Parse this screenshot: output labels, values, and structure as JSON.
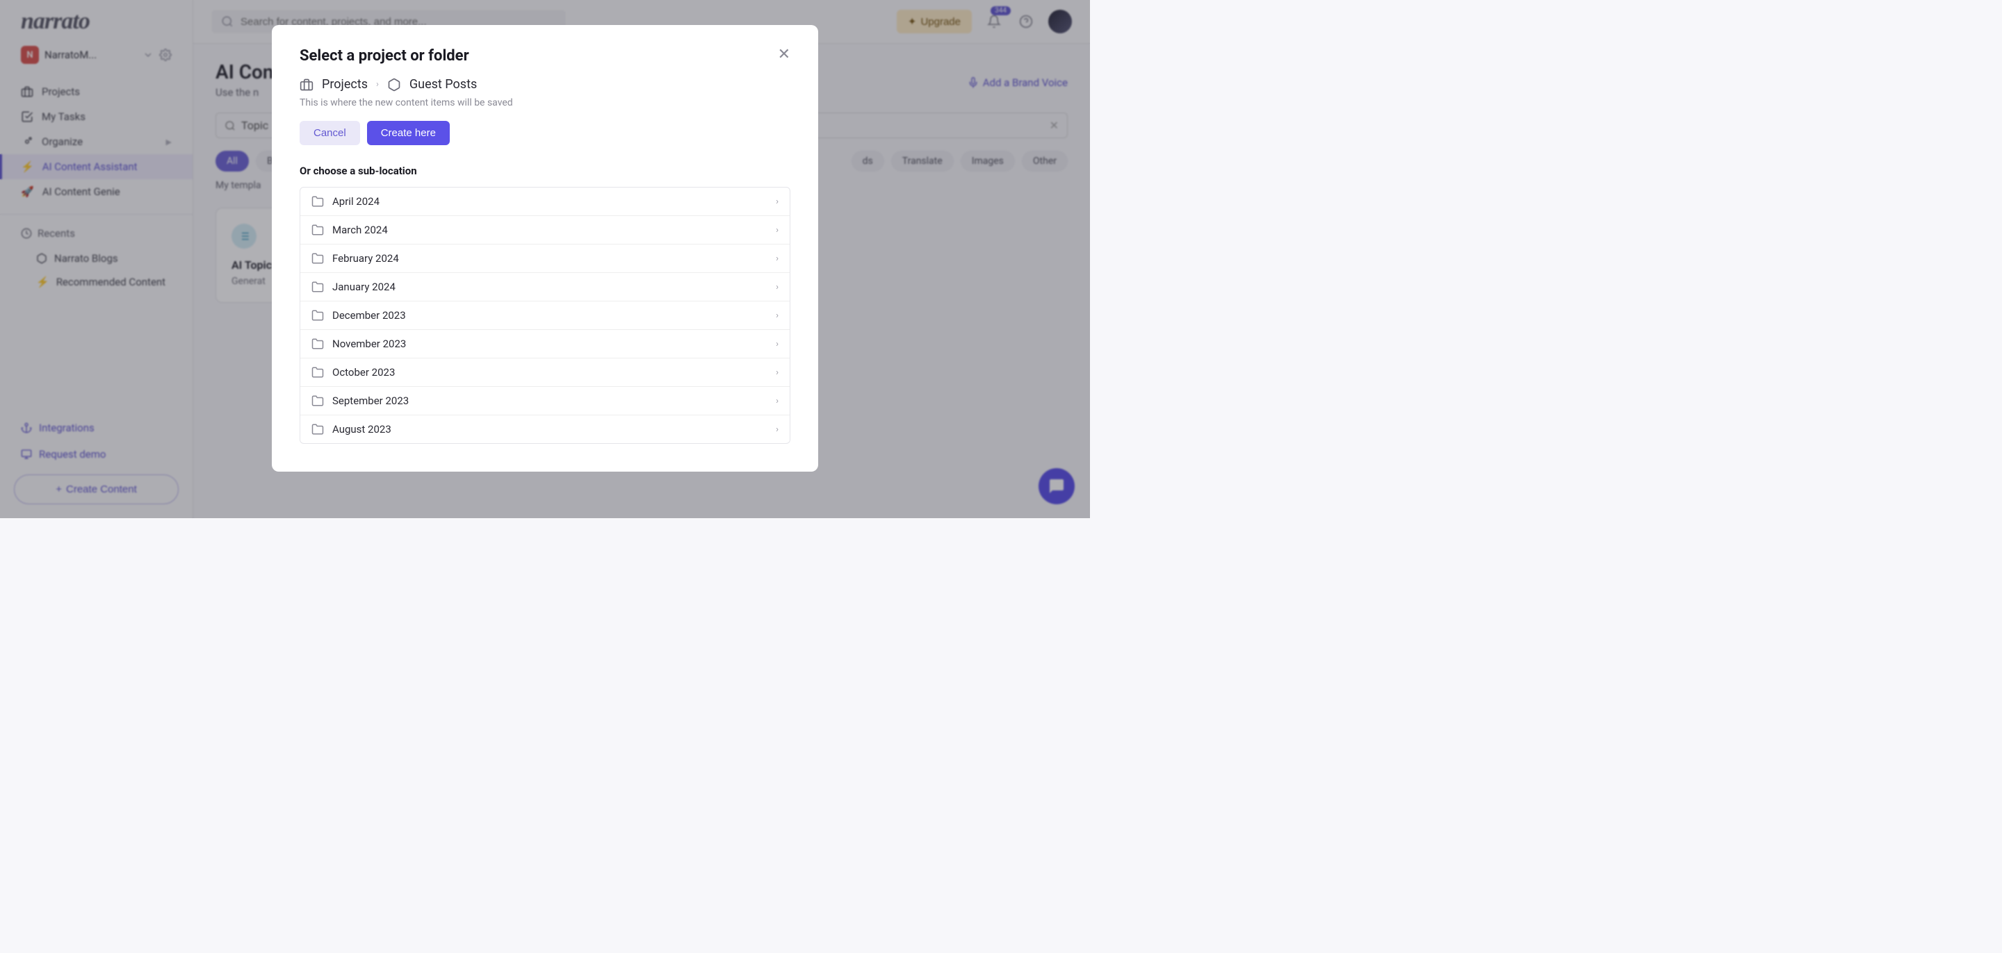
{
  "brand": "narrato",
  "workspace": {
    "badge": "N",
    "name": "NarratoM..."
  },
  "sidebar": {
    "items": [
      {
        "label": "Projects",
        "icon": "briefcase"
      },
      {
        "label": "My Tasks",
        "icon": "check"
      },
      {
        "label": "Organize",
        "icon": "gears",
        "expandable": true
      },
      {
        "label": "AI Content Assistant",
        "icon": "bolt",
        "active": true
      },
      {
        "label": "AI Content Genie",
        "icon": "rocket"
      }
    ],
    "recents_label": "Recents",
    "recents": [
      {
        "label": "Narrato Blogs",
        "icon": "package"
      },
      {
        "label": "Recommended Content",
        "icon": "bolt-yellow"
      }
    ],
    "bottom": {
      "integrations": "Integrations",
      "request_demo": "Request demo",
      "create_content": "Create Content"
    }
  },
  "topbar": {
    "search_placeholder": "Search for content, projects, and more...",
    "upgrade_label": "Upgrade",
    "notif_count": "344"
  },
  "page": {
    "title": "AI Con",
    "subtitle": "Use the n",
    "brand_voice": "Add a Brand Voice",
    "topic_search_label": "Topic"
  },
  "chips": {
    "left": [
      {
        "label": "All",
        "active": true
      },
      {
        "label": "Bl"
      }
    ],
    "right": [
      {
        "label": "ds"
      },
      {
        "label": "Translate"
      },
      {
        "label": "Images"
      },
      {
        "label": "Other"
      }
    ],
    "my_templates": "My templa"
  },
  "card": {
    "title": "AI Topic",
    "desc": "Generat"
  },
  "modal": {
    "title": "Select a project or folder",
    "breadcrumb": [
      "Projects",
      "Guest Posts"
    ],
    "hint": "This is where the new content items will be saved",
    "cancel": "Cancel",
    "create": "Create here",
    "sub_location": "Or choose a sub-location",
    "folders": [
      "April 2024",
      "March 2024",
      "February 2024",
      "January 2024",
      "December 2023",
      "November 2023",
      "October 2023",
      "September 2023",
      "August 2023"
    ]
  }
}
